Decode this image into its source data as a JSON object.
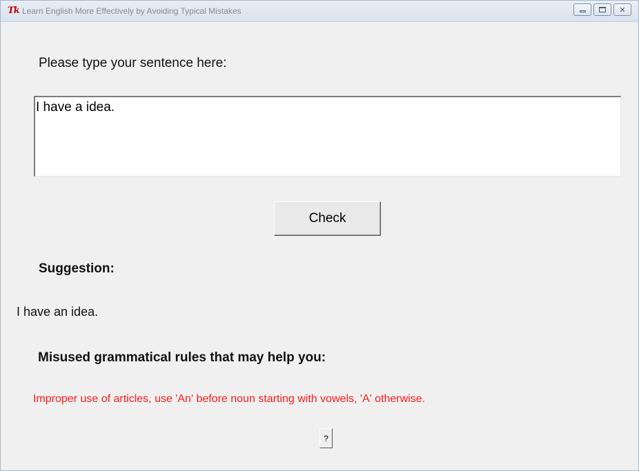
{
  "window": {
    "title": "Learn English More Effectively by Avoiding Typical Mistakes",
    "app_icon": "Tk"
  },
  "window_controls": {
    "minimize_icon": "minimize-icon",
    "maximize_icon": "maximize-icon",
    "close_icon": "close-icon",
    "close_glyph": "✕"
  },
  "form": {
    "prompt_label": "Please type your sentence here:",
    "sentence_value": "I have a idea.",
    "check_label": "Check"
  },
  "result": {
    "suggestion_heading": "Suggestion:",
    "suggestion_text": "I have an idea.",
    "rules_heading": "Misused grammatical rules that may help you:",
    "rule_text": "Improper use of articles, use 'An' before noun starting with vowels, 'A' otherwise.",
    "rule_color": "#ff1a1a",
    "help_label": "?"
  }
}
